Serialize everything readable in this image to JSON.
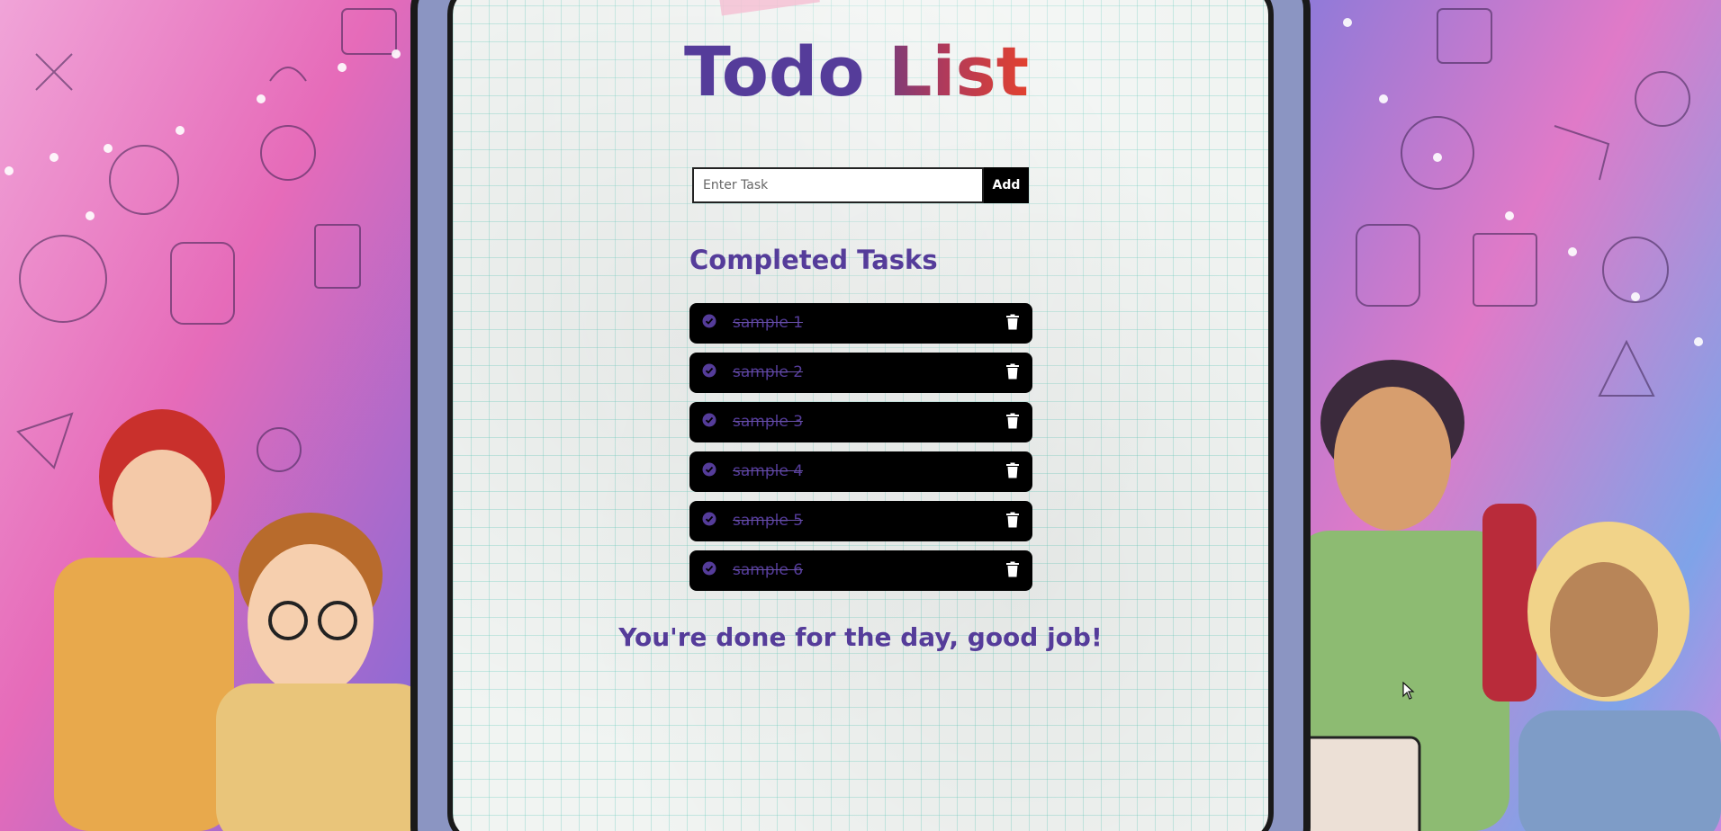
{
  "app": {
    "title_part1": "Todo",
    "title_part2": "List"
  },
  "form": {
    "placeholder": "Enter Task",
    "value": "",
    "add_label": "Add"
  },
  "completed": {
    "heading": "Completed Tasks",
    "tasks": [
      {
        "text": "sample 1",
        "done": true
      },
      {
        "text": "sample 2",
        "done": true
      },
      {
        "text": "sample 3",
        "done": true
      },
      {
        "text": "sample 4",
        "done": true
      },
      {
        "text": "sample 5",
        "done": true
      },
      {
        "text": "sample 6",
        "done": true
      }
    ]
  },
  "message": "You're done for the day, good job!",
  "colors": {
    "primary_text": "#553c9a",
    "title_gradient_start": "#7d3b78",
    "title_gradient_end": "#e2412f",
    "task_background": "#000000",
    "frame": "#8b95c2"
  },
  "icons": {
    "check": "check-circle-icon",
    "delete": "trash-icon"
  }
}
